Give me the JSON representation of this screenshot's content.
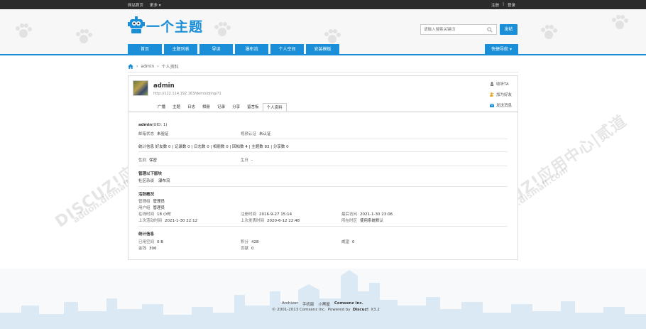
{
  "topbar": {
    "home": "网站首页",
    "more": "更多",
    "register": "注册",
    "divider": "|",
    "login": "登录"
  },
  "header": {
    "logo_text": "一个主题",
    "search_placeholder": "请输入搜索关键词",
    "post_button": "发帖",
    "quick_nav": "快捷导航"
  },
  "nav": [
    {
      "label": "首页"
    },
    {
      "label": "主题列表"
    },
    {
      "label": "导读"
    },
    {
      "label": "瀑布流"
    },
    {
      "label": "个人空间"
    },
    {
      "label": "安装模板"
    }
  ],
  "breadcrumb": {
    "site": "admin",
    "page": "个人资料"
  },
  "profile": {
    "name": "admin",
    "url": "http://122.114.192.163/demo/qiing/?1",
    "actions": [
      "收听TA",
      "加为好友",
      "发送消息"
    ],
    "tabs": [
      "广播",
      "主题",
      "日志",
      "相册",
      "记录",
      "分享",
      "留言板",
      "个人资料"
    ],
    "active_tab": "个人资料",
    "uid_name": "admin",
    "uid_text": "(UID: 1)",
    "email_status_k": "邮箱状态",
    "email_status_v": "未验证",
    "video_k": "视频认证",
    "video_v": "未认证",
    "stats_line": "统计信息  好友数 0  |  记录数 0  |  日志数 0  |  相册数 0  |  回帖数 4  |  主题数 83  |  分享数 0",
    "gender_k": "性别",
    "gender_v": "保密",
    "birthday_k": "生日",
    "birthday_v": "-",
    "section_moderator": "管理以下版块",
    "moderated": [
      "社区杂谈",
      "瀑布流"
    ],
    "section_activity": "活跃概况",
    "admin_group_k": "管理组",
    "admin_group_v": "管理员",
    "user_group_k": "用户组",
    "user_group_v": "管理员",
    "online_k": "在线时间",
    "online_v": "18 小时",
    "reg_k": "注册时间",
    "reg_v": "2016-9-27 15:14",
    "last_visit_k": "最后访问",
    "last_visit_v": "2021-1-30 23:06",
    "last_active_k": "上次活动时间",
    "last_active_v": "2021-1-30 22:12",
    "last_post_k": "上次发表时间",
    "last_post_v": "2020-6-12 22:48",
    "tz_k": "所在时区",
    "tz_v": "使用系统默认",
    "section_stats": "统计信息",
    "space_k": "已用空间",
    "space_v": "0 B",
    "credits_k": "积分",
    "credits_v": "428",
    "prestige_k": "威望",
    "prestige_v": "0",
    "money_k": "金钱",
    "money_v": "306",
    "contrib_k": "贡献",
    "contrib_v": "0"
  },
  "footer": {
    "links": [
      "Archiver",
      "手机版",
      "小黑屋",
      "Comsenz Inc."
    ],
    "copyright": "© 2001-2013 Comsenz Inc.",
    "powered": "Powered by",
    "discuz": "Discuz!",
    "version": "X3.2"
  },
  "watermark": {
    "main": "DISCUZ!应用中心|贰道",
    "sub": "addon.dismall.com"
  },
  "colors": {
    "accent": "#1a8fd8",
    "topbar": "#2b2b2b"
  }
}
